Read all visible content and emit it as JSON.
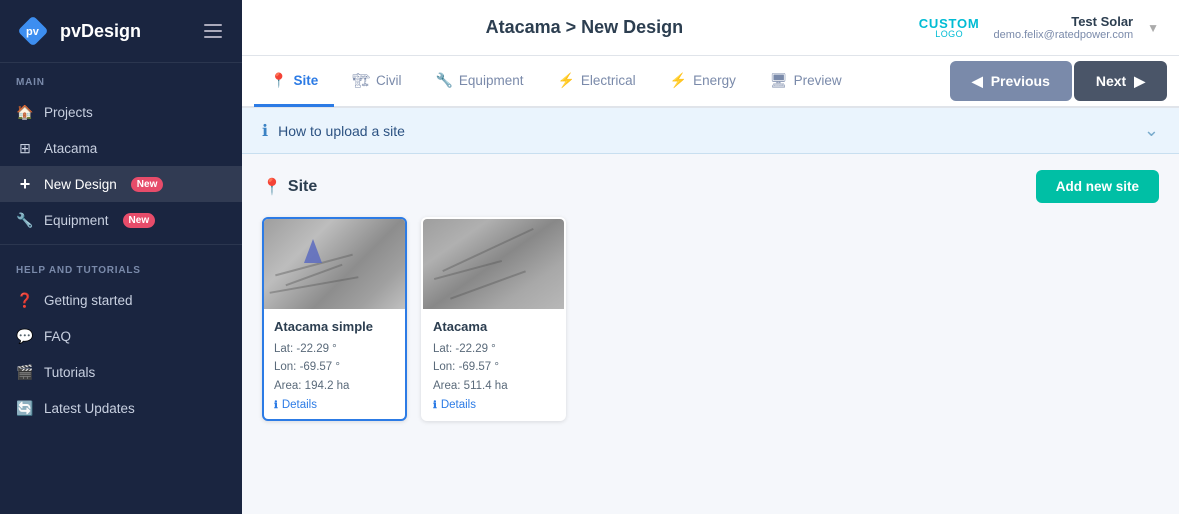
{
  "brand": {
    "logo_text": "pvDesign",
    "hamburger_label": "menu"
  },
  "sidebar": {
    "main_label": "MAIN",
    "items": [
      {
        "id": "projects",
        "label": "Projects",
        "icon": "🏠"
      },
      {
        "id": "atacama",
        "label": "Atacama",
        "icon": "⊞"
      },
      {
        "id": "new-design",
        "label": "New Design",
        "icon": "+",
        "badge": "New",
        "active": true
      },
      {
        "id": "equipment",
        "label": "Equipment",
        "icon": "🔧",
        "badge": "New"
      }
    ],
    "help_label": "HELP AND TUTORIALS",
    "help_items": [
      {
        "id": "getting-started",
        "label": "Getting started",
        "icon": "?"
      },
      {
        "id": "faq",
        "label": "FAQ",
        "icon": "💬"
      },
      {
        "id": "tutorials",
        "label": "Tutorials",
        "icon": "📹"
      },
      {
        "id": "latest-updates",
        "label": "Latest Updates",
        "icon": "🔄"
      }
    ]
  },
  "header": {
    "title": "Atacama > New Design",
    "custom_label": "CUSTOM",
    "custom_sub": "LOGO",
    "user_name": "Test Solar",
    "user_email": "demo.felix@ratedpower.com"
  },
  "tabs": [
    {
      "id": "site",
      "label": "Site",
      "icon": "📍",
      "active": true
    },
    {
      "id": "civil",
      "label": "Civil",
      "icon": "🏗"
    },
    {
      "id": "equipment",
      "label": "Equipment",
      "icon": "🔧"
    },
    {
      "id": "electrical",
      "label": "Electrical",
      "icon": "⚡"
    },
    {
      "id": "energy",
      "label": "Energy",
      "icon": "⚡"
    },
    {
      "id": "preview",
      "label": "Preview",
      "icon": "🖥"
    }
  ],
  "buttons": {
    "previous": "Previous",
    "next": "Next"
  },
  "info_banner": {
    "text": "How to upload a site"
  },
  "site_section": {
    "title": "Site",
    "add_button": "Add new site"
  },
  "site_cards": [
    {
      "name": "Atacama simple",
      "lat": "Lat: -22.29 °",
      "lon": "Lon: -69.57 °",
      "area": "Area: 194.2 ha",
      "details_label": "Details",
      "selected": true
    },
    {
      "name": "Atacama",
      "lat": "Lat: -22.29 °",
      "lon": "Lon: -69.57 °",
      "area": "Area: 511.4 ha",
      "details_label": "Details",
      "selected": false
    }
  ]
}
